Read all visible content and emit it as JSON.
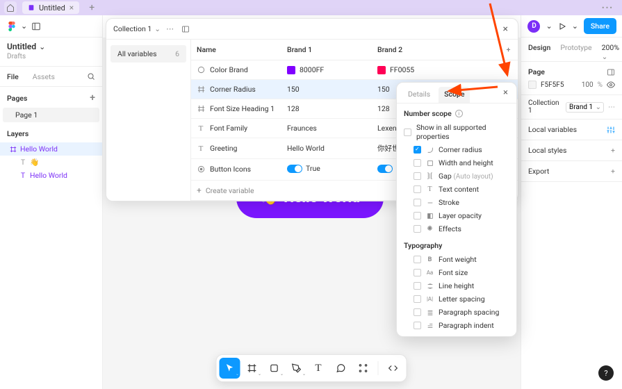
{
  "topbar": {
    "tab_title": "Untitled",
    "menu_dots": "•••"
  },
  "file": {
    "title": "Untitled",
    "location": "Drafts",
    "tabs": {
      "file": "File",
      "assets": "Assets"
    },
    "pages_label": "Pages",
    "pages": [
      "Page 1"
    ],
    "layers_label": "Layers",
    "layer_root": "Hello World",
    "layer_emoji": "👋",
    "layer_text": "Hello World"
  },
  "right": {
    "share": "Share",
    "tabs": {
      "design": "Design",
      "prototype": "Prototype"
    },
    "zoom": "200%",
    "page_label": "Page",
    "page_color": "F5F5F5",
    "page_opacity": "100",
    "page_opacity_unit": "%",
    "collection": "Collection 1",
    "brand": "Brand 1",
    "local_variables": "Local variables",
    "local_styles": "Local styles",
    "export": "Export"
  },
  "canvas": {
    "pill_emoji": "👋",
    "pill_text": "Hello World"
  },
  "variables_panel": {
    "collection": "Collection 1",
    "sidebar": {
      "all_variables": "All variables",
      "count": "6"
    },
    "columns": {
      "name": "Name",
      "brand1": "Brand 1",
      "brand2": "Brand 2"
    },
    "rows": [
      {
        "type": "color",
        "name": "Color Brand",
        "v1": "8000FF",
        "c1": "#8000FF",
        "v2": "FF0055",
        "c2": "#FF0055"
      },
      {
        "type": "number",
        "name": "Corner Radius",
        "v1": "150",
        "v2": "150",
        "selected": true
      },
      {
        "type": "number",
        "name": "Font Size Heading 1",
        "v1": "128",
        "v2": "128"
      },
      {
        "type": "string",
        "name": "Font Family",
        "v1": "Fraunces",
        "v2": "Lexend"
      },
      {
        "type": "string",
        "name": "Greeting",
        "v1": "Hello World",
        "v2": "你好世界"
      },
      {
        "type": "boolean",
        "name": "Button Icons",
        "v1": "True",
        "v2": "True"
      }
    ],
    "create": "Create variable"
  },
  "scope": {
    "tabs": {
      "details": "Details",
      "scope": "Scope"
    },
    "number_scope": "Number scope",
    "show_all": "Show in all supported properties",
    "items": [
      {
        "label": "Corner radius",
        "icon": "corner",
        "checked": true
      },
      {
        "label": "Width and height",
        "icon": "wh"
      },
      {
        "label": "Gap",
        "suffix": "(Auto layout)",
        "icon": "gap"
      },
      {
        "label": "Text content",
        "icon": "text"
      },
      {
        "label": "Stroke",
        "icon": "stroke"
      },
      {
        "label": "Layer opacity",
        "icon": "opacity"
      },
      {
        "label": "Effects",
        "icon": "effects"
      }
    ],
    "typography_label": "Typography",
    "typography": [
      {
        "label": "Font weight",
        "icon": "B"
      },
      {
        "label": "Font size",
        "icon": "Aa"
      },
      {
        "label": "Line height",
        "icon": "lh"
      },
      {
        "label": "Letter spacing",
        "icon": "ls"
      },
      {
        "label": "Paragraph spacing",
        "icon": "ps"
      },
      {
        "label": "Paragraph indent",
        "icon": "pi"
      }
    ]
  },
  "avatar_letter": "D"
}
